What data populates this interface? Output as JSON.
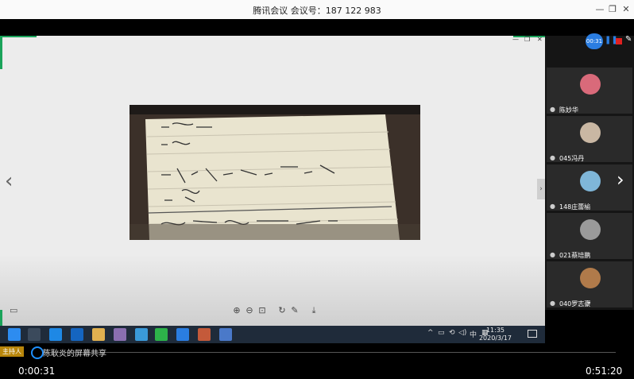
{
  "window": {
    "title": "腾讯会议 会议号：187 122 983",
    "minimize_glyph": "—",
    "restore_glyph": "❐",
    "close_glyph": "✕"
  },
  "share_screen": {
    "mini_minimize": "—",
    "mini_restore": "❐",
    "mini_close": "✕",
    "left_arrow": "‹",
    "side_handle": "›",
    "viewer_tools": [
      "⊕",
      "⊖",
      "⊡",
      "↻",
      "✎",
      "⤓"
    ],
    "monitor_glyph": "▭"
  },
  "taskbar": {
    "input_method": "中",
    "clock_time": "11:35",
    "clock_date": "2020/3/17",
    "tray_symbols": [
      "^",
      "▭",
      "⟲",
      "◁)",
      "中",
      "▦"
    ]
  },
  "share_bar": {
    "host_badge": "主持人",
    "label": "陈耿炎的屏幕共享"
  },
  "playback": {
    "current_time": "0:00:31",
    "total_time": "0:51:20",
    "progress": 0.01
  },
  "recording": {
    "timer": "00:31",
    "pause": "❚❚",
    "pen": "✎"
  },
  "participants": [
    {
      "name": "陈妙华",
      "avatar_color": "#d96a7a"
    },
    {
      "name": "045冯丹",
      "avatar_color": "#c9b7a3"
    },
    {
      "name": "148庄蕾榆",
      "avatar_color": "#7fb6d8"
    },
    {
      "name": "021蔡培鹏",
      "avatar_color": "#9a9a9a"
    },
    {
      "name": "040罗志豪",
      "avatar_color": "#b07a4a"
    }
  ],
  "panel_nav": {
    "next_arrow": "›",
    "down_chevron": "⌄"
  }
}
